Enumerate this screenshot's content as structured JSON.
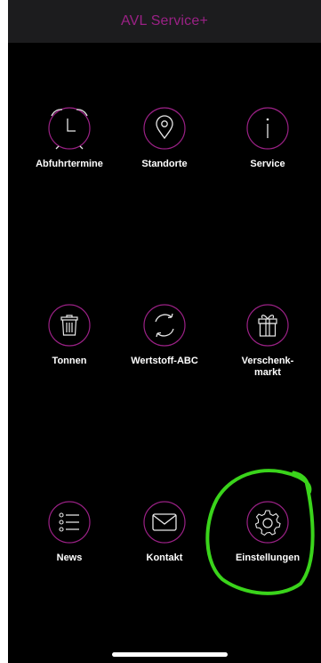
{
  "header": {
    "title": "AVL Service+"
  },
  "accent_color": "#9a2185",
  "tiles": [
    {
      "label": "Abfuhrtermine",
      "icon": "alarm-clock-icon"
    },
    {
      "label": "Standorte",
      "icon": "location-pin-icon"
    },
    {
      "label": "Service",
      "icon": "info-icon"
    },
    {
      "label": "Tonnen",
      "icon": "trash-bin-icon"
    },
    {
      "label": "Wertstoff-ABC",
      "icon": "recycle-icon"
    },
    {
      "label": "Verschenk-\nmarkt",
      "icon": "gift-icon"
    },
    {
      "label": "News",
      "icon": "list-icon"
    },
    {
      "label": "Kontakt",
      "icon": "envelope-icon"
    },
    {
      "label": "Einstellungen",
      "icon": "gear-icon"
    }
  ],
  "annotation": {
    "highlight_color": "#3ad41b",
    "highlighted_tile": "Einstellungen"
  }
}
